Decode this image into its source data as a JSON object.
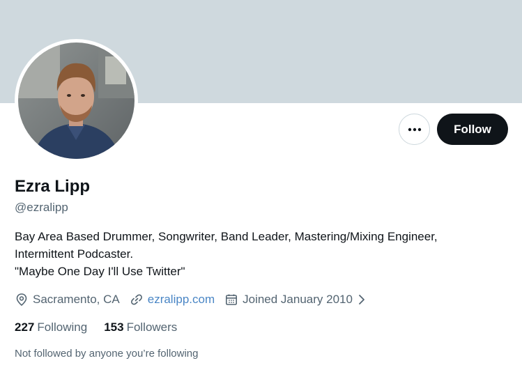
{
  "profile": {
    "display_name": "Ezra Lipp",
    "handle": "@ezralipp",
    "bio_lines": [
      "Bay Area Based Drummer, Songwriter, Band Leader, Mastering/Mixing Engineer,",
      "Intermittent Podcaster.",
      "\"Maybe One Day I'll Use Twitter\""
    ],
    "location": "Sacramento, CA",
    "website": "ezralipp.com",
    "joined": "Joined January 2010"
  },
  "actions": {
    "follow_label": "Follow",
    "more_icon": "ellipsis-icon"
  },
  "stats": {
    "following_count": "227",
    "following_label": "Following",
    "followers_count": "153",
    "followers_label": "Followers"
  },
  "social_context": "Not followed by anyone you’re following",
  "colors": {
    "banner": "#cfd9de",
    "follow_button": "#0f1419",
    "link": "#4a86c5",
    "secondary_text": "#536471"
  }
}
